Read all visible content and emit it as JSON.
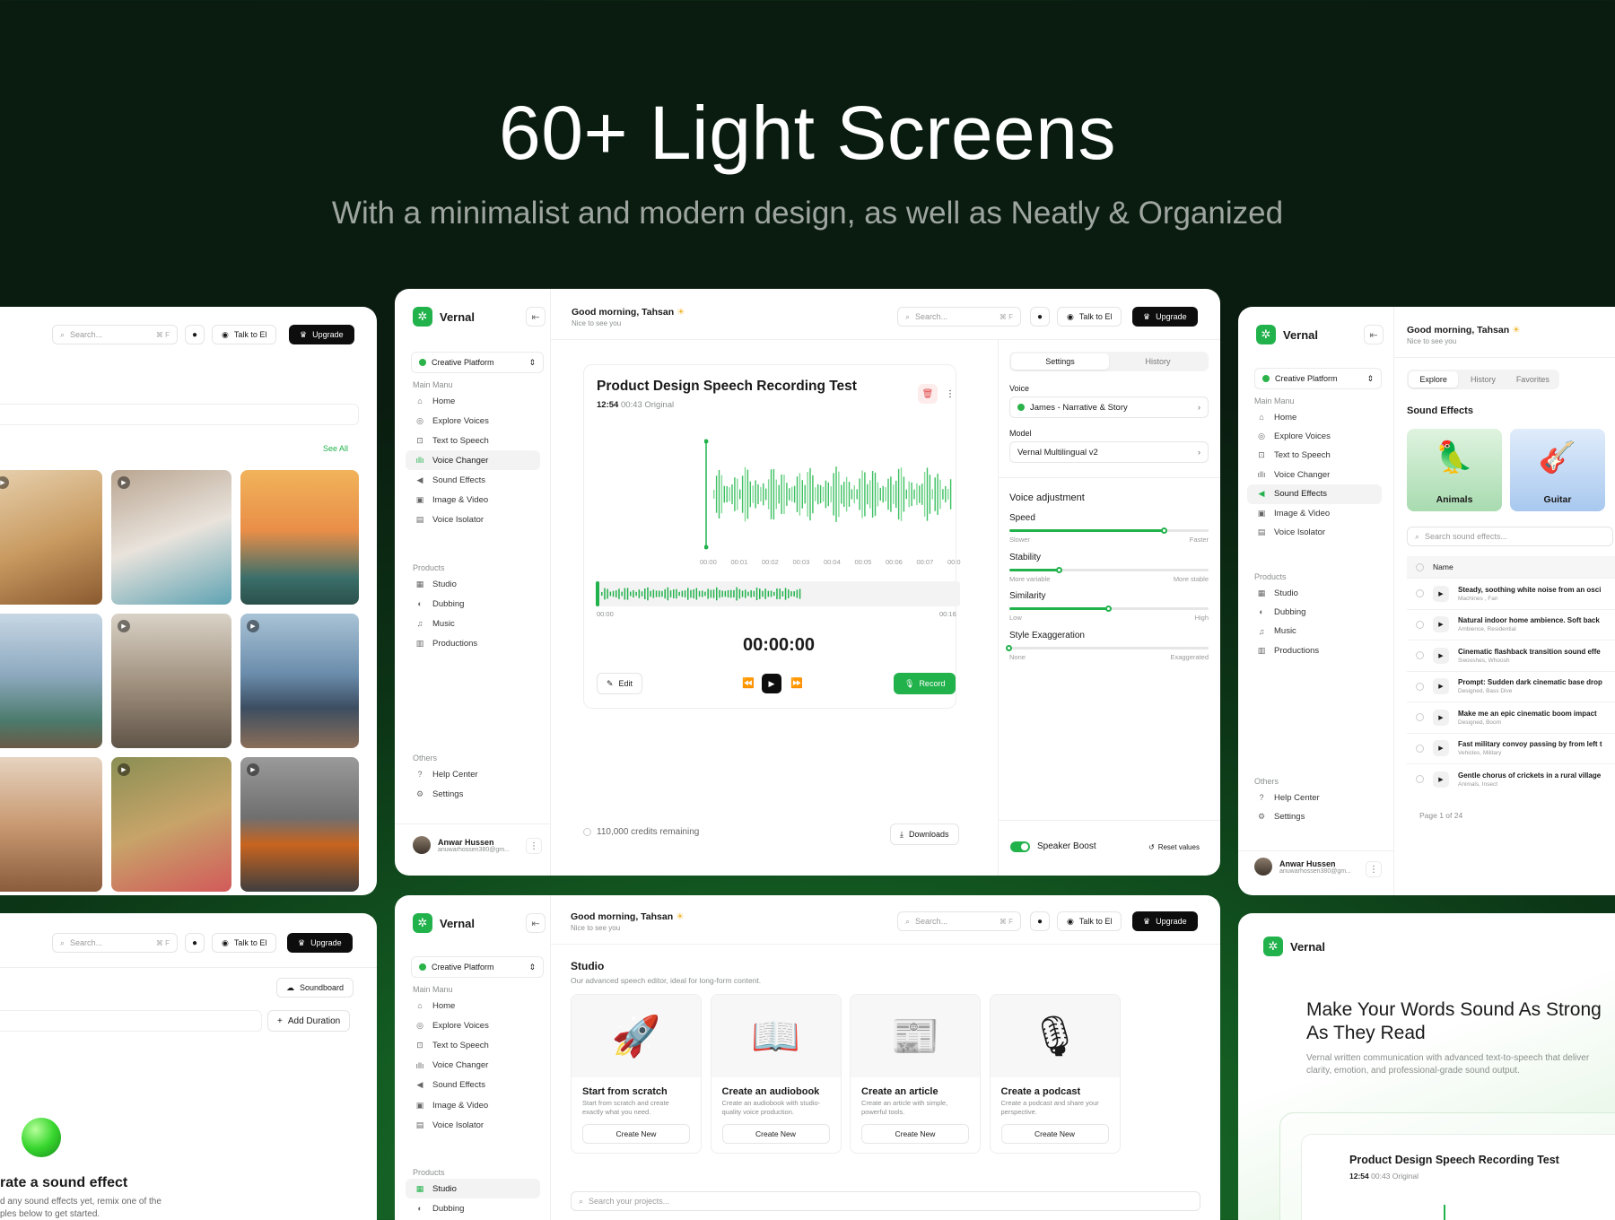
{
  "hero": {
    "title": "60+ Light Screens",
    "subtitle": "With a minimalist and modern design, as well as Neatly & Organized"
  },
  "app": {
    "brand": "Vernal",
    "workspace": "Creative Platform",
    "greeting": "Good morning, Tahsan",
    "greeting_sub": "Nice to see you",
    "search_placeholder": "Search...",
    "search_kbd": "⌘ F",
    "talk_label": "Talk to El",
    "upgrade_label": "Upgrade",
    "main_menu_label": "Main Manu",
    "products_label": "Products",
    "others_label": "Others",
    "nav_main": [
      "Home",
      "Explore Voices",
      "Text to Speech",
      "Voice Changer",
      "Sound Effects",
      "Image & Video",
      "Voice Isolator"
    ],
    "nav_main_icons": [
      "home-icon",
      "globe-icon",
      "text-scan-icon",
      "waveform-icon",
      "speaker-icon",
      "image-icon",
      "file-icon"
    ],
    "nav_products": [
      "Studio",
      "Dubbing",
      "Music",
      "Productions"
    ],
    "nav_others": [
      "Help Center",
      "Settings"
    ],
    "user_name": "Anwar Hussen",
    "user_email": "anuwarhossen380@gm..."
  },
  "center": {
    "recording_title": "Product Design Speech Recording Test",
    "time_label": "12:54",
    "duration_label": "00:43 Original",
    "time_ticks": [
      "00:00",
      "00:01",
      "00:02",
      "00:03",
      "00:04",
      "00:05",
      "00:06",
      "00:07",
      "00:0"
    ],
    "scrub_start": "00:00",
    "scrub_end": "00:16",
    "timer": "00:00:00",
    "edit_label": "Edit",
    "record_label": "Record",
    "credits": "110,000 credits remaining",
    "downloads_label": "Downloads",
    "tabs": [
      "Settings",
      "History"
    ],
    "voice_label": "Voice",
    "voice_value": "James - Narrative & Story",
    "model_label": "Model",
    "model_value": "Vernal Multilingual v2",
    "adjust_title": "Voice adjustment",
    "sliders": [
      {
        "label": "Speed",
        "min": "Slower",
        "max": "Faster",
        "value": 0.78
      },
      {
        "label": "Stability",
        "min": "More variable",
        "max": "More stable",
        "value": 0.25
      },
      {
        "label": "Similarity",
        "min": "Low",
        "max": "High",
        "value": 0.5
      },
      {
        "label": "Style Exaggeration",
        "min": "None",
        "max": "Exaggerated",
        "value": 0.0
      }
    ],
    "speaker_boost": "Speaker Boost",
    "reset_label": "Reset values"
  },
  "left_top": {
    "see_all": "See All"
  },
  "left_bottom": {
    "soundboard": "Soundboard",
    "add_duration": "Add Duration",
    "heading": "rate a sound effect",
    "desc_1": "d any sound effects yet, remix one of the",
    "desc_2": "ples below to get started."
  },
  "right_top": {
    "tabs": [
      "Explore",
      "History",
      "Favorites"
    ],
    "section": "Sound Effects",
    "categories": [
      "Animals",
      "Guitar"
    ],
    "search_placeholder": "Search sound effects...",
    "name_header": "Name",
    "rows": [
      {
        "title": "Steady, soothing white noise from an osci",
        "tags": "Machines , Fan"
      },
      {
        "title": "Natural indoor home ambience. Soft back",
        "tags": "Ambience, Residential"
      },
      {
        "title": "Cinematic flashback transition sound effe",
        "tags": "Swooshes, Whoosh"
      },
      {
        "title": "Prompt: Sudden dark cinematic base drop",
        "tags": "Designed, Bass Dive"
      },
      {
        "title": "Make me an epic cinematic boom impact",
        "tags": "Designed, Boom"
      },
      {
        "title": "Fast military convoy passing by from left t",
        "tags": "Vehicles, Military"
      },
      {
        "title": "Gentle chorus of crickets in a rural village",
        "tags": "Animals, Insect"
      }
    ],
    "page": "Page 1 of 24"
  },
  "bottom_center": {
    "title": "Studio",
    "subtitle": "Our advanced speech editor, ideal for long-form content.",
    "cards": [
      {
        "title": "Start from scratch",
        "desc": "Start from scratch and create exactly what you need.",
        "button": "Create New"
      },
      {
        "title": "Create an audiobook",
        "desc": "Create an audiobook with studio-quality voice production.",
        "button": "Create New"
      },
      {
        "title": "Create an article",
        "desc": "Create an article with simple, powerful tools.",
        "button": "Create New"
      },
      {
        "title": "Create a podcast",
        "desc": "Create a podcast and share your perspective.",
        "button": "Create New"
      }
    ],
    "search_placeholder": "Search your projects..."
  },
  "bottom_right": {
    "headline_1": "Make Your Words Sound As Strong",
    "headline_2": "As They Read",
    "desc_1": "Vernal written communication with advanced text-to-speech that deliver",
    "desc_2": "clarity, emotion, and professional-grade sound output.",
    "card_title": "Product Design Speech Recording Test",
    "card_time": "12:54",
    "card_duration": "00:43 Original"
  },
  "colors": {
    "accent": "#22b24c",
    "dark": "#0d0d0d"
  }
}
